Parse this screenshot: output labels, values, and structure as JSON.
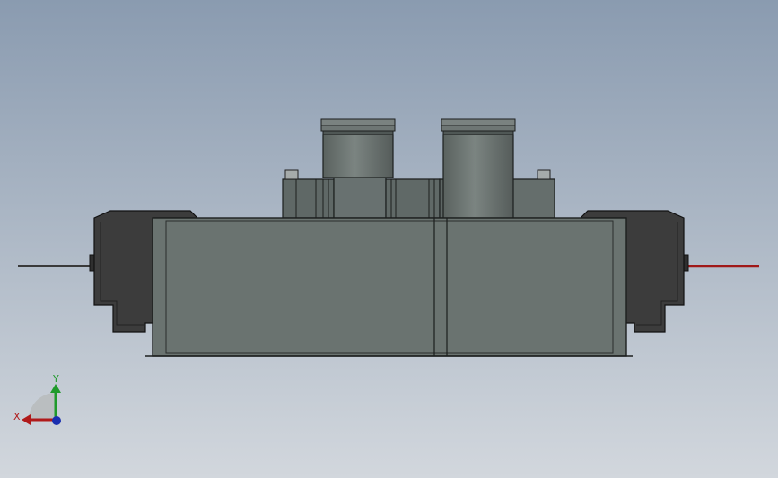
{
  "viewport": {
    "background_top": "#8a9bb0",
    "background_bottom": "#d2d7dd"
  },
  "model": {
    "body_color": "#6a7370",
    "body_dark": "#3a3a3a",
    "edge_color": "#1c1f1e",
    "wire_left_color": "#3a3a3a",
    "wire_right_color": "#a01818"
  },
  "triad": {
    "x_label": "X",
    "y_label": "Y",
    "x_color": "#b01a1a",
    "y_color": "#1f9a2a",
    "z_color": "#1a2fb0"
  }
}
